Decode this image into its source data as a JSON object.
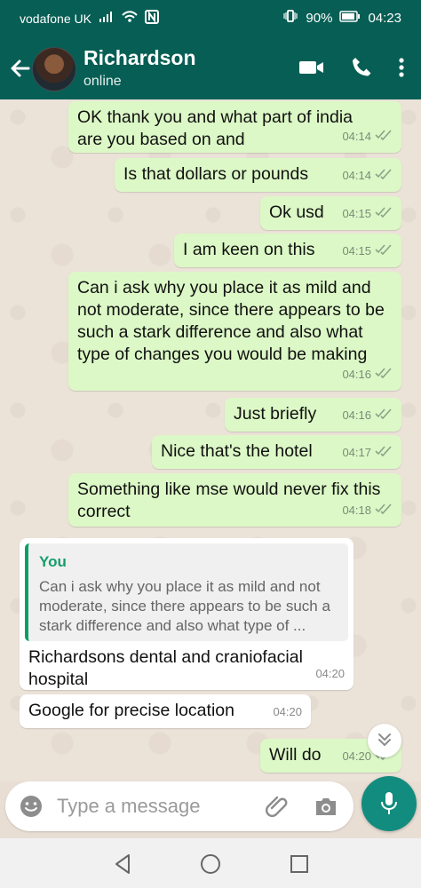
{
  "status_bar": {
    "carrier": "vodafone UK",
    "battery": "90%",
    "time": "04:23"
  },
  "header": {
    "name": "Richardson",
    "status": "online",
    "icons": [
      "back-arrow-icon",
      "video-call-icon",
      "phone-icon",
      "more-vertical-icon"
    ]
  },
  "messages": [
    {
      "text": "OK thank you and what part of india are you based on and",
      "time": "04:14",
      "direction": "out"
    },
    {
      "text": "Is that dollars or pounds",
      "time": "04:14",
      "direction": "out"
    },
    {
      "text": "Ok usd",
      "time": "04:15",
      "direction": "out"
    },
    {
      "text": "I am keen on this",
      "time": "04:15",
      "direction": "out"
    },
    {
      "text": "Can i ask why you place it as mild and not moderate, since there appears to be such a stark difference and also what type of changes you would be making",
      "time": "04:16",
      "direction": "out"
    },
    {
      "text": "Just briefly",
      "time": "04:16",
      "direction": "out"
    },
    {
      "text": "Nice that's the hotel",
      "time": "04:17",
      "direction": "out"
    },
    {
      "text": "Something like mse would never fix this correct",
      "time": "04:18",
      "direction": "out"
    },
    {
      "text": "Richardsons dental and craniofacial hospital",
      "time": "04:20",
      "direction": "in",
      "quote": {
        "author": "You",
        "text": "Can i ask why you place it as mild and not moderate, since there appears to be such a stark difference and also what type of ..."
      }
    },
    {
      "text": "Google for precise location",
      "time": "04:20",
      "direction": "in"
    },
    {
      "text": "Will do",
      "time": "04:20",
      "direction": "out"
    }
  ],
  "composer": {
    "placeholder": "Type a message"
  },
  "colors": {
    "header": "#075e54",
    "outgoing_bubble": "#dcf8c6",
    "incoming_bubble": "#ffffff",
    "accent": "#128c7e"
  }
}
